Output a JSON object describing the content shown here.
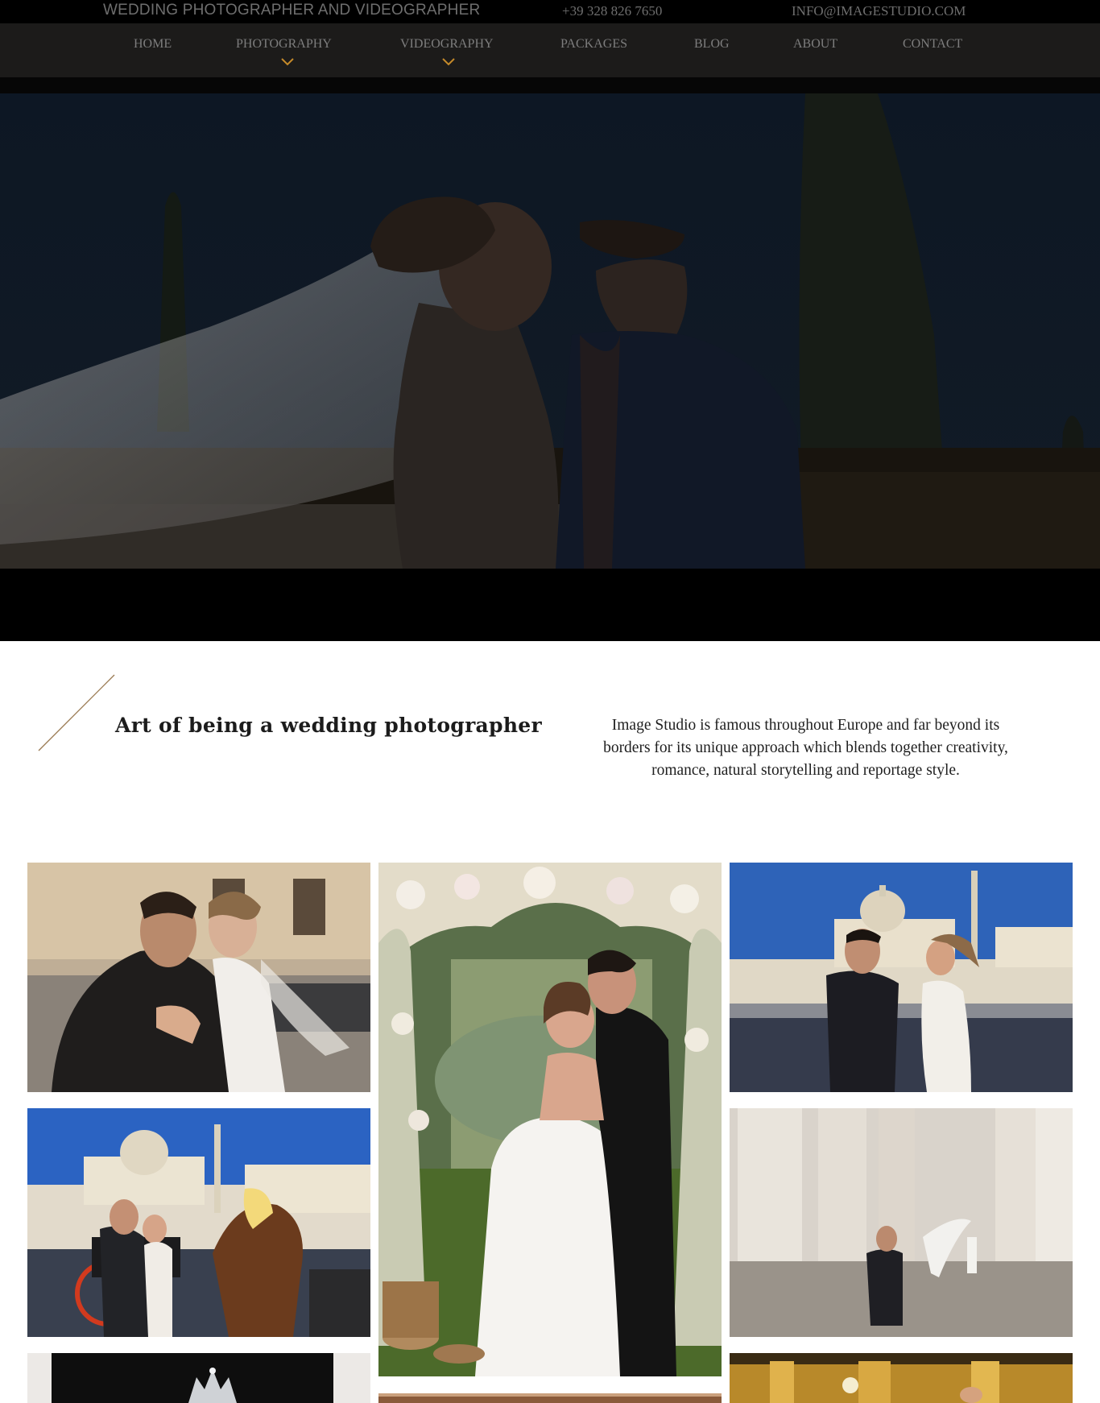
{
  "topbar": {
    "tagline": "WEDDING PHOTOGRAPHER AND VIDEOGRAPHER",
    "phone": "+39 328 826 7650",
    "email": "INFO@IMAGESTUDIO.COM"
  },
  "nav": {
    "items": [
      {
        "label": "HOME",
        "has_dropdown": false
      },
      {
        "label": "PHOTOGRAPHY",
        "has_dropdown": true
      },
      {
        "label": "VIDEOGRAPHY",
        "has_dropdown": true
      },
      {
        "label": "PACKAGES",
        "has_dropdown": false
      },
      {
        "label": "BLOG",
        "has_dropdown": false
      },
      {
        "label": "ABOUT",
        "has_dropdown": false
      },
      {
        "label": "CONTACT",
        "has_dropdown": false
      }
    ],
    "chevron_icon": "chevron-down-icon",
    "accent_color": "#c58a2a"
  },
  "intro": {
    "title": "Art of being a wedding photographer",
    "text": "Image Studio is famous throughout Europe and far beyond its borders for its unique approach which blends together creativity, romance, natural storytelling and reportage style.",
    "accent_color": "#9a7a52"
  },
  "gallery": {
    "photos": [
      "couple-embrace-rome-street",
      "couple-under-flower-arch",
      "couple-st-peters-square",
      "couple-with-horse-carriage",
      "groom-bride-colonnade",
      "bridal-tiara",
      "reception-hall",
      "couple-partial-bottom"
    ]
  }
}
